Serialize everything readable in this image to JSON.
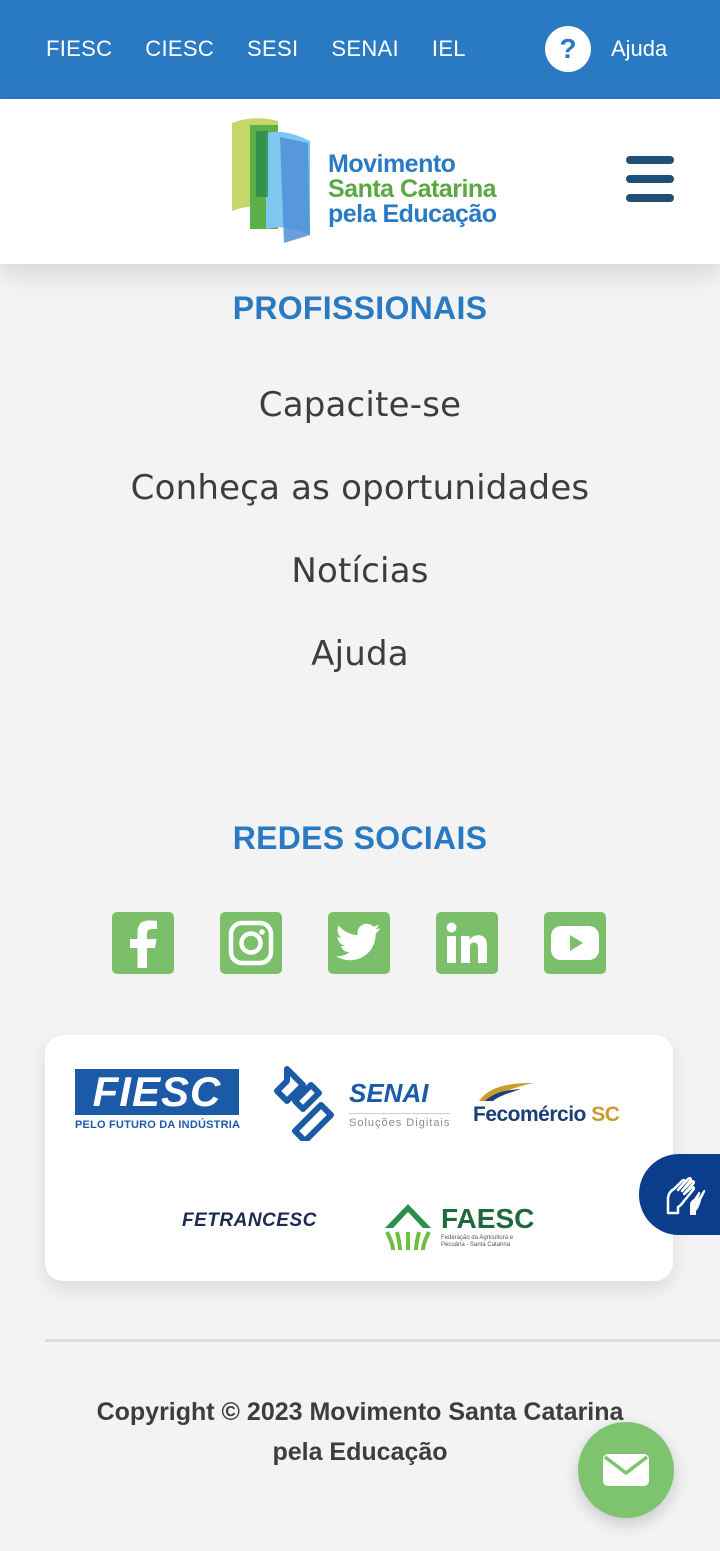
{
  "topbar": {
    "links": [
      "FIESC",
      "CIESC",
      "SESI",
      "SENAI",
      "IEL"
    ],
    "help_icon": "?",
    "help_label": "Ajuda"
  },
  "header": {
    "logo": {
      "line1": "Movimento",
      "line2": "Santa Catarina",
      "line3": "pela Educação"
    },
    "menu_icon": "hamburger-menu-icon"
  },
  "profissionais": {
    "title": "PROFISSIONAIS",
    "items": [
      "Capacite-se",
      "Conheça as oportunidades",
      "Notícias",
      "Ajuda"
    ]
  },
  "redes": {
    "title": "REDES SOCIAIS",
    "icons": [
      "facebook-icon",
      "instagram-icon",
      "twitter-icon",
      "linkedin-icon",
      "youtube-icon"
    ]
  },
  "partners": {
    "fiesc": {
      "name": "FIESC",
      "tagline": "PELO FUTURO DA INDÚSTRIA"
    },
    "senai": {
      "name": "SENAI",
      "tagline": "Soluções Digitais"
    },
    "fecomercio": {
      "name": "Fecomércio",
      "suffix": "SC"
    },
    "fetrancesc": {
      "name": "FETRANCESC"
    },
    "faesc": {
      "name": "FAESC",
      "tagline": "Federação da Agricultura e Pecuária - Santa Catarina"
    }
  },
  "footer": {
    "copyright_line1": "Copyright © 2023 Movimento Santa Catarina",
    "copyright_line2": "pela Educação"
  },
  "floating": {
    "accessibility_icon": "sign-language-hands-icon",
    "mail_icon": "envelope-icon"
  },
  "colors": {
    "topbar": "#2a7ac3",
    "title_blue": "#2a7ac3",
    "social_green": "#7bbf6a",
    "a11y_navy": "#0a3d8c",
    "fab_green": "#7ec46f"
  }
}
